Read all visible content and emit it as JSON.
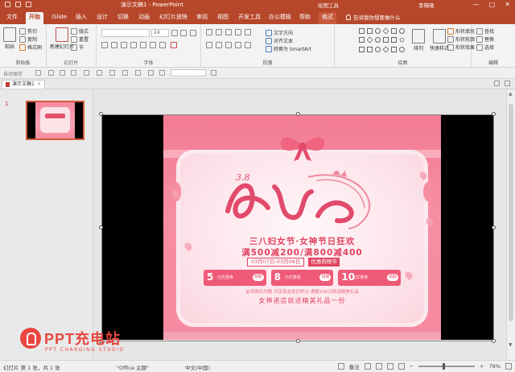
{
  "titlebar": {
    "title": "演示文稿1 - PowerPoint",
    "context": "绘图工具",
    "user": "李晓晓",
    "win_min": "—",
    "win_max": "□",
    "win_close": "✕"
  },
  "tabs": [
    {
      "label": "文件"
    },
    {
      "label": "开始"
    },
    {
      "label": "iSlide"
    },
    {
      "label": "插入"
    },
    {
      "label": "设计"
    },
    {
      "label": "切换"
    },
    {
      "label": "动画"
    },
    {
      "label": "幻灯片放映"
    },
    {
      "label": "审阅"
    },
    {
      "label": "视图"
    },
    {
      "label": "开发工具"
    },
    {
      "label": "办公模板"
    },
    {
      "label": "帮助"
    },
    {
      "label": "格式"
    }
  ],
  "tell_me": "告诉我你想要做什么",
  "ribbon": {
    "clipboard": {
      "paste": "粘贴",
      "cut": "剪切",
      "copy": "复制",
      "format_painter": "格式刷",
      "label": "剪贴板"
    },
    "slides": {
      "new_slide": "新建幻灯片",
      "layout": "版式",
      "reset": "重置",
      "section": "节",
      "label": "幻灯片"
    },
    "font": {
      "font_size": "24",
      "label": "字体"
    },
    "paragraph": {
      "text_direction": "文字方向",
      "align_text": "对齐文本",
      "smartart": "转换为 SmartArt",
      "label": "段落"
    },
    "drawing": {
      "arrange": "排列",
      "quick_styles": "快速样式",
      "fill": "形状填充",
      "outline": "形状轮廓",
      "effects": "形状效果",
      "label": "绘图"
    },
    "editing": {
      "find": "查找",
      "replace": "替换",
      "select": "选择",
      "label": "编辑"
    }
  },
  "quick_row": {
    "autosave": "自动保存"
  },
  "doc_tab": {
    "label": "演示文稿1"
  },
  "thumbs": {
    "slide_number": "1"
  },
  "poster": {
    "date_top": "3.8",
    "line1": "三八妇女节·女神节日狂欢",
    "line2": "满500减200/满800减400",
    "date_range": "03月07日-03月08日",
    "date_tag": "优惠购物节",
    "coupons": [
      {
        "amount": "5",
        "note": "元优惠券",
        "tag": "领取"
      },
      {
        "amount": "8",
        "note": "元优惠券",
        "tag": "领取"
      },
      {
        "amount": "10",
        "note": "元优惠券",
        "tag": "领取"
      }
    ],
    "note": "会员购买均赠 可享现金抵扣积分 满额100元即送精美礼品",
    "line3": "女神进店就送精美礼品一份"
  },
  "watermark": {
    "title": "PPT充电站",
    "subtitle": "PPT CHARGING STUDIO"
  },
  "status": {
    "slide_info": "幻灯片 第 1 张，共 1 张",
    "theme": "\"Office 主题\"",
    "language": "中文(中国)",
    "notes": "备注",
    "zoom": "79%"
  }
}
